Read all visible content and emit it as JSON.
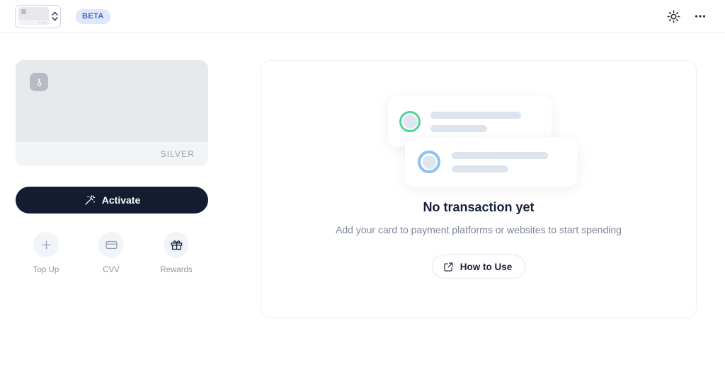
{
  "header": {
    "card_selector": {
      "name": "card-selector",
      "mini_card_tier": "SILVER",
      "stepper_icon": "chevron-up-down-icon"
    },
    "beta_label": "BETA",
    "theme_toggle_icon": "sun-icon",
    "more_menu_icon": "ellipsis-horizontal-icon"
  },
  "card": {
    "logo_icon": "brand-key-icon",
    "tier": "SILVER",
    "background_color": "#e7e9ec",
    "footer_color": "#f3f4f6",
    "tier_text_color": "#9ba1ab"
  },
  "activate": {
    "label": "Activate",
    "icon": "magic-wand-icon",
    "background_color": "#131c31",
    "text_color": "#ffffff"
  },
  "actions": [
    {
      "label": "Top Up",
      "icon": "plus-icon",
      "icon_color": "#98a0af"
    },
    {
      "label": "CVV",
      "icon": "credit-card-icon",
      "icon_color": "#98a0af"
    },
    {
      "label": "Rewards",
      "icon": "gift-icon",
      "icon_color": "#1b2440"
    }
  ],
  "empty_state": {
    "title": "No transaction yet",
    "subtitle": "Add your card to payment platforms or websites to start spending",
    "how_to_use": {
      "label": "How to Use",
      "icon": "external-link-icon"
    },
    "illustration": {
      "back_card_ring_color": "#4fd698",
      "front_card_ring_color": "#8ec1f3",
      "skeleton_bar_color": "#dde4ee"
    }
  },
  "theme": {
    "page_background": "#ffffff",
    "accent_dark": "#131c31",
    "beta_badge_bg": "#dfe7fb",
    "beta_badge_text": "#4766c9",
    "muted_text": "#7d8597"
  }
}
